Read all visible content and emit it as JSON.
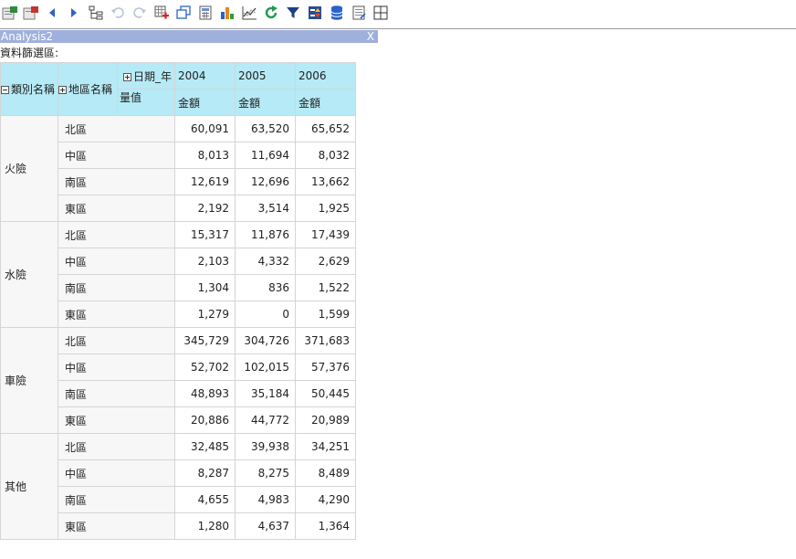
{
  "panel": {
    "title": "Analysis2",
    "close_label": "X"
  },
  "filter_label": "資料篩選區:",
  "toolbar_icons": [
    "export-excel-icon",
    "export-pdf-icon",
    "previous-icon",
    "next-icon",
    "hierarchy-icon",
    "undo-icon",
    "redo-icon",
    "add-calculation-icon",
    "copy-window-icon",
    "calculator-icon",
    "bar-chart-icon",
    "line-chart-icon",
    "refresh-icon",
    "filter-icon",
    "sort-icon",
    "database-icon",
    "report-icon",
    "grid-icon"
  ],
  "pivot": {
    "row_header_1": "類別名稱",
    "row_header_2": "地區名稱",
    "col_dim": "日期_年",
    "measure_label": "量值",
    "years": [
      "2004",
      "2005",
      "2006"
    ],
    "measure": "金額",
    "groups": [
      {
        "category": "火險",
        "rows": [
          {
            "region": "北區",
            "values": [
              "60,091",
              "63,520",
              "65,652"
            ]
          },
          {
            "region": "中區",
            "values": [
              "8,013",
              "11,694",
              "8,032"
            ]
          },
          {
            "region": "南區",
            "values": [
              "12,619",
              "12,696",
              "13,662"
            ]
          },
          {
            "region": "東區",
            "values": [
              "2,192",
              "3,514",
              "1,925"
            ]
          }
        ]
      },
      {
        "category": "水險",
        "rows": [
          {
            "region": "北區",
            "values": [
              "15,317",
              "11,876",
              "17,439"
            ]
          },
          {
            "region": "中區",
            "values": [
              "2,103",
              "4,332",
              "2,629"
            ]
          },
          {
            "region": "南區",
            "values": [
              "1,304",
              "836",
              "1,522"
            ]
          },
          {
            "region": "東區",
            "values": [
              "1,279",
              "0",
              "1,599"
            ]
          }
        ]
      },
      {
        "category": "車險",
        "rows": [
          {
            "region": "北區",
            "values": [
              "345,729",
              "304,726",
              "371,683"
            ]
          },
          {
            "region": "中區",
            "values": [
              "52,702",
              "102,015",
              "57,376"
            ]
          },
          {
            "region": "南區",
            "values": [
              "48,893",
              "35,184",
              "50,445"
            ]
          },
          {
            "region": "東區",
            "values": [
              "20,886",
              "44,772",
              "20,989"
            ]
          }
        ]
      },
      {
        "category": "其他",
        "rows": [
          {
            "region": "北區",
            "values": [
              "32,485",
              "39,938",
              "34,251"
            ]
          },
          {
            "region": "中區",
            "values": [
              "8,287",
              "8,275",
              "8,489"
            ]
          },
          {
            "region": "南區",
            "values": [
              "4,655",
              "4,983",
              "4,290"
            ]
          },
          {
            "region": "東區",
            "values": [
              "1,280",
              "4,637",
              "1,364"
            ]
          }
        ]
      }
    ]
  }
}
